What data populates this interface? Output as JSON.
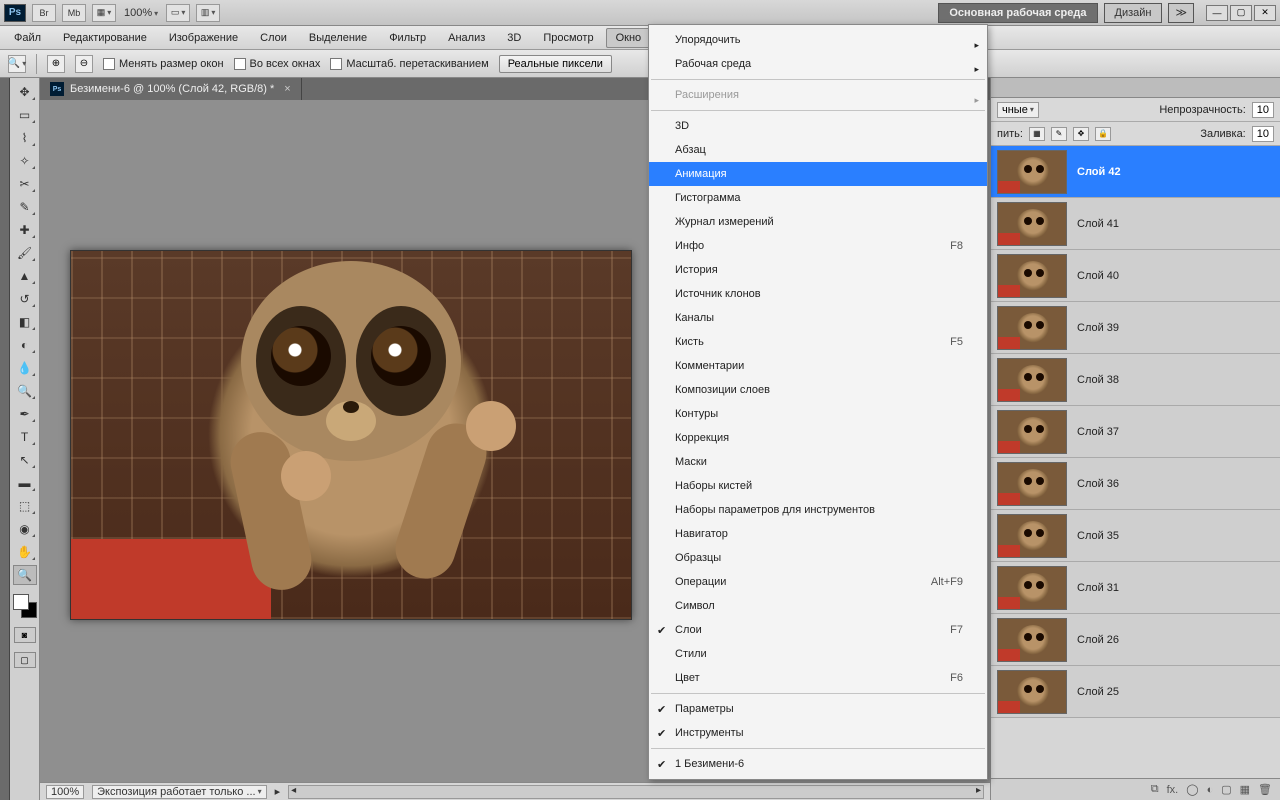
{
  "top": {
    "ps": "Ps",
    "br": "Br",
    "mb": "Mb",
    "zoom": "100%",
    "workspace_main": "Основная рабочая среда",
    "workspace_design": "Дизайн",
    "more": "≫"
  },
  "menu": {
    "items": [
      "Файл",
      "Редактирование",
      "Изображение",
      "Слои",
      "Выделение",
      "Фильтр",
      "Анализ",
      "3D",
      "Просмотр",
      "Окно"
    ],
    "open_index": 9
  },
  "options": {
    "resize_windows": "Менять размер окон",
    "all_windows": "Во всех окнах",
    "drag_zoom": "Масштаб. перетаскиванием",
    "actual_pixels": "Реальные пиксели"
  },
  "doc": {
    "title": "Безимени-6 @ 100% (Слой 42, RGB/8) *",
    "status_zoom": "100%",
    "status_info": "Экспозиция работает только ..."
  },
  "panel": {
    "blend_suffix": "чные",
    "opacity_label": "Непрозрачность:",
    "opacity_value": "10",
    "lock_label": "пить:",
    "fill_label": "Заливка:",
    "fill_value": "10"
  },
  "layers": [
    {
      "name": "Слой 42",
      "selected": true
    },
    {
      "name": "Слой 41"
    },
    {
      "name": "Слой 40"
    },
    {
      "name": "Слой 39"
    },
    {
      "name": "Слой 38"
    },
    {
      "name": "Слой 37"
    },
    {
      "name": "Слой 36"
    },
    {
      "name": "Слой 35"
    },
    {
      "name": "Слой 31"
    },
    {
      "name": "Слой 26"
    },
    {
      "name": "Слой 25"
    }
  ],
  "layer_footer": {
    "link": "⧉",
    "fx": "fx.",
    "mask": "◯",
    "adjust": "◐",
    "folder": "▢",
    "new": "▦",
    "trash": "🗑"
  },
  "window_menu": {
    "groups": [
      [
        {
          "label": "Упорядочить",
          "submenu": true
        },
        {
          "label": "Рабочая среда",
          "submenu": true
        }
      ],
      [
        {
          "label": "Расширения",
          "submenu": true,
          "disabled": true
        }
      ],
      [
        {
          "label": "3D"
        },
        {
          "label": "Абзац"
        },
        {
          "label": "Анимация",
          "highlight": true
        },
        {
          "label": "Гистограмма"
        },
        {
          "label": "Журнал измерений"
        },
        {
          "label": "Инфо",
          "shortcut": "F8"
        },
        {
          "label": "История"
        },
        {
          "label": "Источник клонов"
        },
        {
          "label": "Каналы"
        },
        {
          "label": "Кисть",
          "shortcut": "F5"
        },
        {
          "label": "Комментарии"
        },
        {
          "label": "Композиции слоев"
        },
        {
          "label": "Контуры"
        },
        {
          "label": "Коррекция"
        },
        {
          "label": "Маски"
        },
        {
          "label": "Наборы кистей"
        },
        {
          "label": "Наборы параметров для инструментов"
        },
        {
          "label": "Навигатор"
        },
        {
          "label": "Образцы"
        },
        {
          "label": "Операции",
          "shortcut": "Alt+F9"
        },
        {
          "label": "Символ"
        },
        {
          "label": "Слои",
          "shortcut": "F7",
          "checked": true
        },
        {
          "label": "Стили"
        },
        {
          "label": "Цвет",
          "shortcut": "F6"
        }
      ],
      [
        {
          "label": "Параметры",
          "checked": true
        },
        {
          "label": "Инструменты",
          "checked": true
        }
      ],
      [
        {
          "label": "1 Безимени-6",
          "checked": true
        }
      ]
    ]
  }
}
